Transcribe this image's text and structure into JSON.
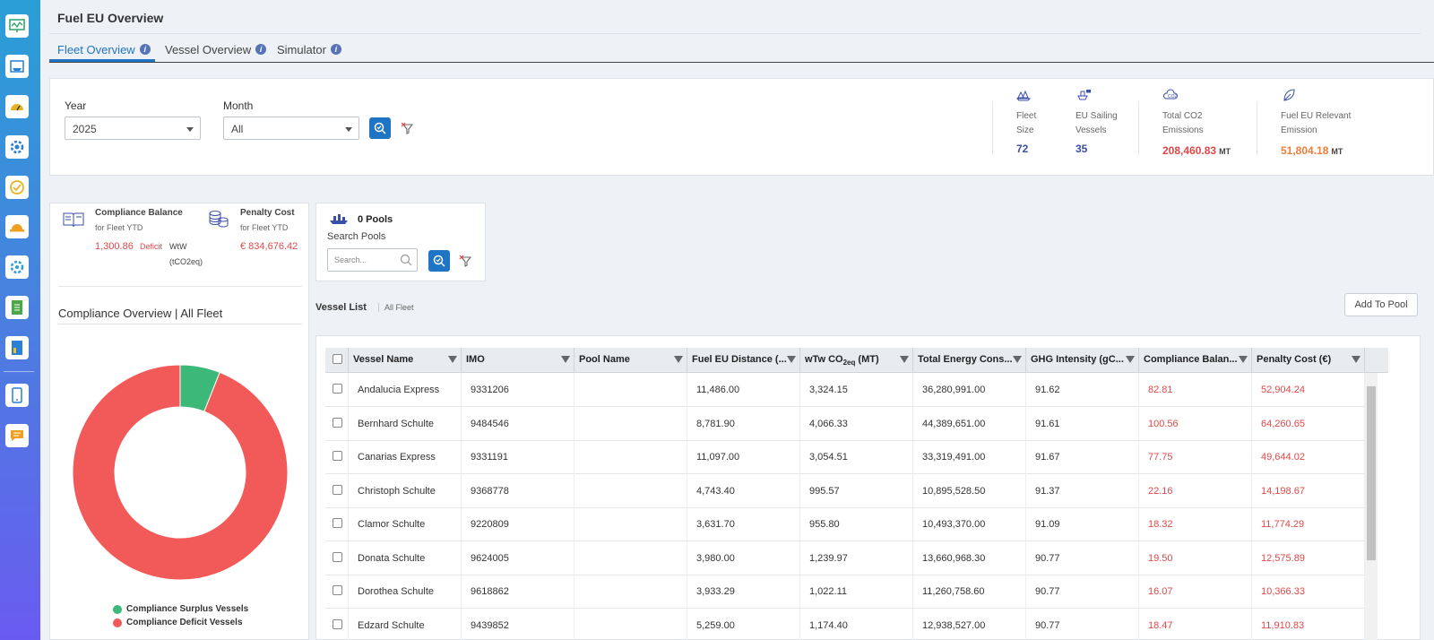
{
  "page_title": "Fuel EU Overview",
  "tabs": [
    {
      "label": "Fleet Overview"
    },
    {
      "label": "Vessel Overview"
    },
    {
      "label": "Simulator"
    }
  ],
  "tab_info_glyph": "i",
  "filters": {
    "year_label": "Year",
    "year_value": "2025",
    "month_label": "Month",
    "month_value": "All"
  },
  "kpis": {
    "fleet_size": {
      "label1": "Fleet",
      "label2": "Size",
      "value": "72",
      "color": "#3c4fa8"
    },
    "eu_sailing": {
      "label1": "EU Sailing",
      "label2": "Vessels",
      "value": "35",
      "color": "#3c4fa8"
    },
    "total_co2": {
      "label1": "Total CO2",
      "label2": "Emissions",
      "value": "208,460.83",
      "unit": "MT",
      "color": "#e04848"
    },
    "fuel_eu": {
      "label1": "Fuel EU Relevant",
      "label2": "Emission",
      "value": "51,804.18",
      "unit": "MT",
      "color": "#f07d3a"
    }
  },
  "compliance": {
    "balance_title": "Compliance Balance",
    "balance_sub": "for Fleet YTD",
    "balance_value": "1,300.86",
    "balance_status": "Deficit",
    "balance_unit1": "WtW",
    "balance_unit2": "(tCO2eq)",
    "penalty_title": "Penalty Cost",
    "penalty_sub": "for Fleet YTD",
    "penalty_value": "€ 834,676.42"
  },
  "chart_title": "Compliance Overview | All Fleet",
  "chart_data": {
    "type": "pie",
    "donut": true,
    "categories": [
      "Compliance Surplus Vessels",
      "Compliance Deficit Vessels"
    ],
    "values": [
      6,
      94
    ],
    "colors": [
      "#3cb878",
      "#f25a5a"
    ],
    "legend": "bottom"
  },
  "pools": {
    "count_label": "0 Pools",
    "search_label": "Search Pools",
    "search_placeholder": "Search..."
  },
  "vessel_list": {
    "title": "Vessel List",
    "scope": "All Fleet",
    "add_to_pool": "Add To Pool"
  },
  "table": {
    "columns": [
      "Vessel Name",
      "IMO",
      "Pool Name",
      "Fuel EU Distance (...",
      "wTw CO",
      "2eq",
      " (MT)",
      "Total Energy Cons...",
      "GHG Intensity (gC...",
      "Compliance Balan...",
      "Penalty Cost (€)"
    ],
    "rows": [
      [
        "Andalucia Express",
        "9331206",
        "",
        "11,486.00",
        "3,324.15",
        "36,280,991.00",
        "91.62",
        "82.81",
        "52,904.24"
      ],
      [
        "Bernhard Schulte",
        "9484546",
        "",
        "8,781.90",
        "4,066.33",
        "44,389,651.00",
        "91.61",
        "100.56",
        "64,260.65"
      ],
      [
        "Canarias Express",
        "9331191",
        "",
        "11,097.00",
        "3,054.51",
        "33,319,491.00",
        "91.67",
        "77.75",
        "49,644.02"
      ],
      [
        "Christoph Schulte",
        "9368778",
        "",
        "4,743.40",
        "995.57",
        "10,895,528.50",
        "91.37",
        "22.16",
        "14,198.67"
      ],
      [
        "Clamor Schulte",
        "9220809",
        "",
        "3,631.70",
        "955.80",
        "10,493,370.00",
        "91.09",
        "18.32",
        "11,774.29"
      ],
      [
        "Donata Schulte",
        "9624005",
        "",
        "3,980.00",
        "1,239.97",
        "13,660,968.30",
        "90.77",
        "19.50",
        "12,575.89"
      ],
      [
        "Dorothea Schulte",
        "9618862",
        "",
        "3,933.29",
        "1,022.11",
        "11,260,758.60",
        "90.77",
        "16.07",
        "10,366.33"
      ],
      [
        "Edzard Schulte",
        "9439852",
        "",
        "5,259.00",
        "1,174.40",
        "12,938,527.00",
        "90.77",
        "18.47",
        "11,910.83"
      ]
    ]
  }
}
